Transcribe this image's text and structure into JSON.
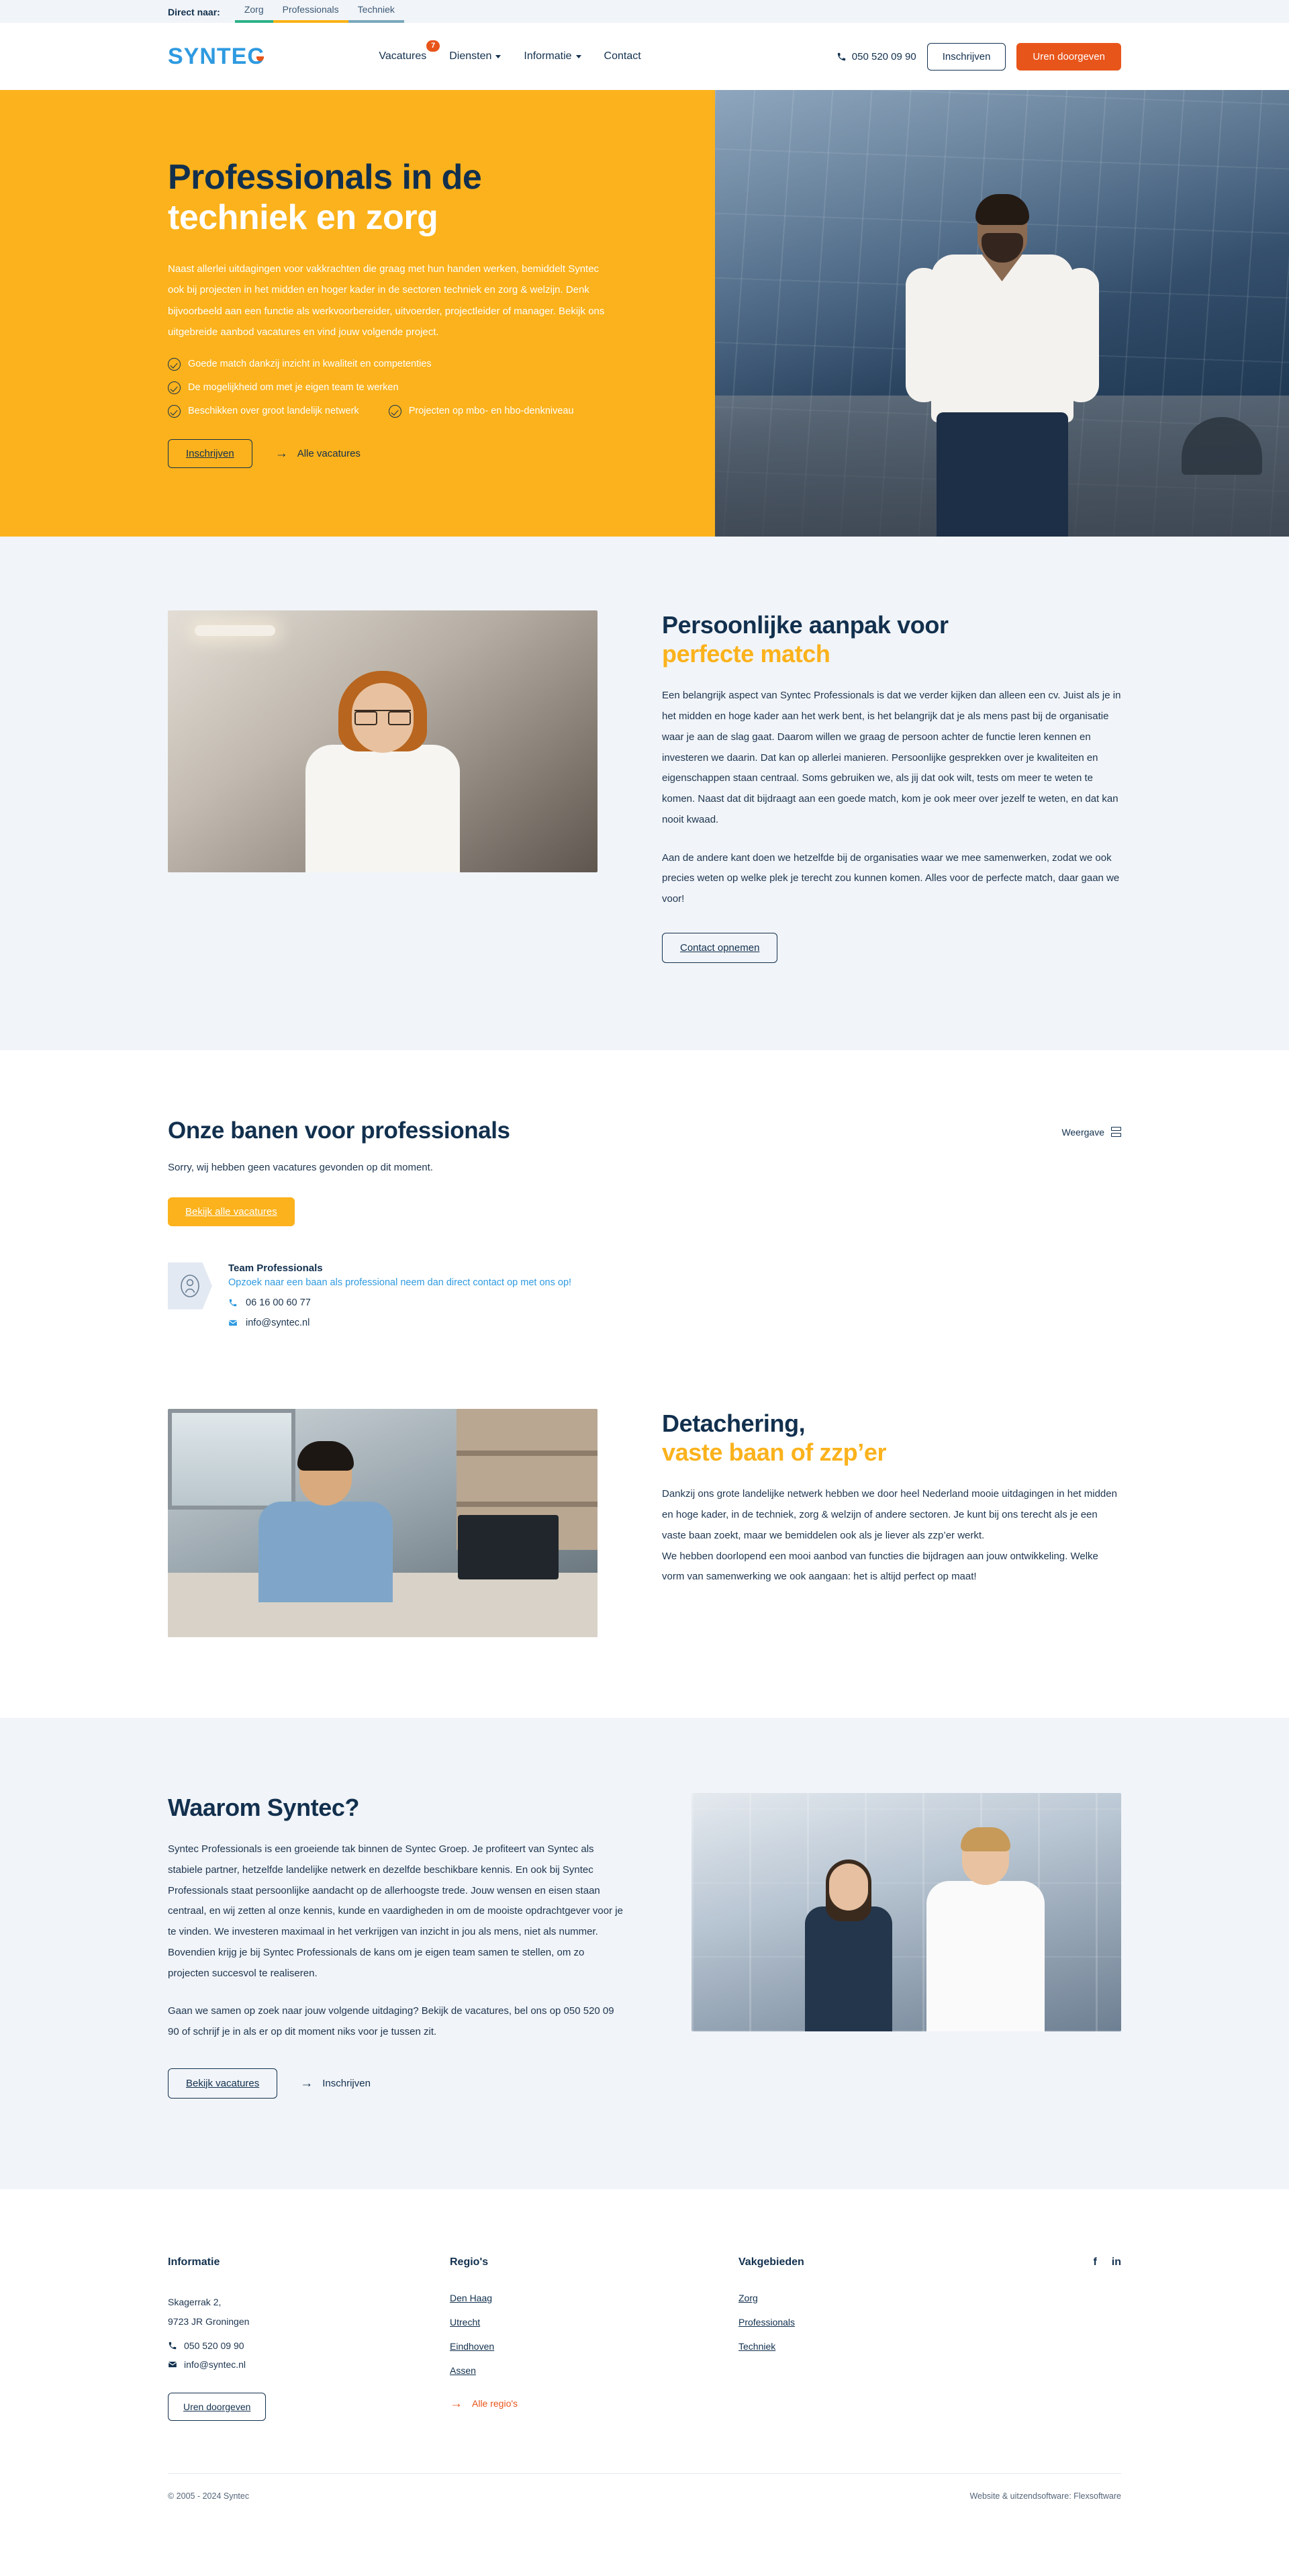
{
  "topbar": {
    "label": "Direct naar:",
    "links": [
      {
        "label": "Zorg",
        "color": "#2bb188"
      },
      {
        "label": "Professionals",
        "color": "#f9b216"
      },
      {
        "label": "Techniek",
        "color": "#79a8bd"
      }
    ]
  },
  "header": {
    "logo": "SYNTEC",
    "nav": [
      {
        "label": "Vacatures",
        "badge": "7",
        "caret": false
      },
      {
        "label": "Diensten",
        "badge": null,
        "caret": true
      },
      {
        "label": "Informatie",
        "badge": null,
        "caret": true
      },
      {
        "label": "Contact",
        "badge": null,
        "caret": false
      }
    ],
    "phone": "050 520 09 90",
    "signup_label": "Inschrijven",
    "hours_label": "Uren doorgeven"
  },
  "hero": {
    "title_line1": "Professionals in de",
    "title_line2": "techniek en zorg",
    "lead": "Naast allerlei uitdagingen voor vakkrachten die graag met hun handen werken, bemiddelt Syntec ook bij projecten in het midden en hoger kader in de sectoren techniek en zorg & welzijn. Denk bijvoorbeeld aan een functie als werkvoorbereider, uitvoerder, projectleider of manager. Bekijk ons uitgebreide aanbod vacatures en vind jouw volgende project.",
    "checks": [
      "Goede match dankzij inzicht in kwaliteit en competenties",
      "De mogelijkheid om met je eigen team te werken",
      "Beschikken over groot landelijk netwerk",
      "Projecten op mbo- en hbo-denkniveau"
    ],
    "cta_primary": "Inschrijven",
    "cta_link": "Alle vacatures"
  },
  "approach": {
    "title_line1": "Persoonlijke aanpak voor",
    "title_line2": "perfecte match",
    "paragraph1": "Een belangrijk aspect van Syntec Professionals is dat we verder kijken dan alleen een cv. Juist als je in het midden en hoge kader aan het werk bent, is het belangrijk dat je als mens past bij de organisatie waar je aan de slag gaat. Daarom willen we graag de persoon achter de functie leren kennen en investeren we daarin. Dat kan op allerlei manieren. Persoonlijke gesprekken over je kwaliteiten en eigenschappen staan centraal. Soms gebruiken we, als jij dat ook wilt, tests om meer te weten te komen. Naast dat dit bijdraagt aan een goede match, kom je ook meer over jezelf te weten, en dat kan nooit kwaad.",
    "paragraph2": "Aan de andere kant doen we hetzelfde bij de organisaties waar we mee samenwerken, zodat we ook precies weten op welke plek je terecht zou kunnen komen. Alles voor de perfecte match, daar gaan we voor!",
    "cta": "Contact opnemen"
  },
  "jobs": {
    "title_part1": "Onze ",
    "title_part2": "banen voor professionals",
    "view_label": "Weergave",
    "empty_message": "Sorry, wij hebben geen vacatures gevonden op dit moment.",
    "cta": "Bekijk alle vacatures",
    "contact": {
      "name": "Team Professionals",
      "subtitle": "Opzoek naar een baan als professional neem dan direct contact op met ons op!",
      "phone": "06 16 00 60 77",
      "email": "info@syntec.nl"
    }
  },
  "secondment": {
    "title_line1": "Detachering,",
    "title_line2": "vaste baan of zzp’er",
    "paragraph1": "Dankzij ons grote landelijke netwerk hebben we door heel Nederland mooie uitdagingen in het midden en hoge kader, in de techniek, zorg & welzijn of andere sectoren. Je kunt bij ons terecht als je een vaste baan zoekt, maar we bemiddelen ook als je liever als zzp’er werkt.",
    "paragraph2": "We hebben doorlopend een mooi aanbod van functies die bijdragen aan jouw ontwikkeling. Welke vorm van samenwerking we ook aangaan: het is altijd perfect op maat!"
  },
  "why": {
    "title": "Waarom Syntec?",
    "paragraph1": "Syntec Professionals is een groeiende tak binnen de Syntec Groep. Je profiteert van Syntec als stabiele partner, hetzelfde landelijke netwerk en dezelfde beschikbare kennis. En ook bij Syntec Professionals staat persoonlijke aandacht op de allerhoogste trede. Jouw wensen en eisen staan centraal, en wij zetten al onze kennis, kunde en vaardigheden in om de mooiste opdrachtgever voor je te vinden. We investeren maximaal in het verkrijgen van inzicht in jou als mens, niet als nummer. Bovendien krijg je bij Syntec Professionals de kans om je eigen team samen te stellen, om zo projecten succesvol te realiseren.",
    "paragraph2": "Gaan we samen op zoek naar jouw volgende uitdaging? Bekijk de vacatures, bel ons op 050 520 09 90 of schrijf je in als er op dit moment niks voor je tussen zit.",
    "cta_primary": "Bekijk vacatures",
    "cta_link": "Inschrijven"
  },
  "footer": {
    "col1": {
      "heading": "Informatie",
      "address_line1": "Skagerrak 2,",
      "address_line2": "9723 JR Groningen",
      "phone": "050 520 09 90",
      "email": "info@syntec.nl",
      "button": "Uren doorgeven"
    },
    "col2": {
      "heading": "Regio's",
      "links": [
        "Den Haag",
        "Utrecht",
        "Eindhoven",
        "Assen"
      ],
      "all_link": "Alle regio's"
    },
    "col3": {
      "heading": "Vakgebieden",
      "links": [
        "Zorg",
        "Professionals",
        "Techniek"
      ]
    },
    "social": [
      {
        "name": "facebook-icon",
        "glyph": "f"
      },
      {
        "name": "linkedin-icon",
        "glyph": "in"
      }
    ],
    "copyright": "© 2005 - 2024 Syntec",
    "credit": "Website & uitzendsoftware: Flexsoftware"
  },
  "colors": {
    "amber": "#fbb21c",
    "orange": "#e8551a",
    "navy": "#12304e",
    "blue": "#2e9ae0",
    "grey_bg": "#f1f4f8",
    "green": "#2bb188",
    "steel": "#79a8bd"
  }
}
